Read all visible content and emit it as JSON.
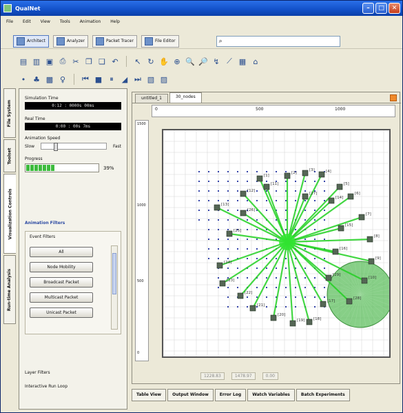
{
  "window": {
    "title": "QualNet"
  },
  "menu": [
    "File",
    "Edit",
    "View",
    "Tools",
    "Animation",
    "Help"
  ],
  "modes": [
    {
      "label": "Architect",
      "active": true
    },
    {
      "label": "Analyzer",
      "active": false
    },
    {
      "label": "Packet Tracer",
      "active": false
    },
    {
      "label": "File Editor",
      "active": false
    }
  ],
  "search": {
    "icon": "search-icon",
    "value": ""
  },
  "side_tabs": [
    "File System",
    "Toolset",
    "Visualization Controls",
    "Run-time Analysis"
  ],
  "sim": {
    "sim_time_label": "Simulation Time",
    "sim_time_value": "0:12 : 0000s  00ms",
    "real_time_label": "Real Time",
    "real_time_value": "0:00 : 00s 7ms",
    "speed_label": "Animation Speed",
    "speed_min": "Slow",
    "speed_max": "Fast",
    "speed_fraction": 0.2,
    "progress_label": "Progress",
    "progress_percent": 39,
    "progress_text": "39%"
  },
  "filters": {
    "title": "Animation Filters",
    "event_title": "Event Filters",
    "buttons": [
      "All",
      "Node Mobility",
      "Broadcast Packet",
      "Multicast Packet",
      "Unicast Packet"
    ],
    "layer_filters": "Layer Filters",
    "interactive_log": "Interactive Run Loop"
  },
  "doc_tabs": [
    "untitled_1",
    "30_nodes"
  ],
  "ruler": {
    "top_ticks": [
      "0",
      "500",
      "1000"
    ],
    "left_ticks": [
      "1500",
      "1000",
      "500",
      "0"
    ]
  },
  "coords": [
    "1228.83",
    "1478.97",
    "0.00"
  ],
  "bottom_tabs": [
    "Table View",
    "Output Window",
    "Error Log",
    "Watch Variables",
    "Batch Experiments"
  ],
  "node_labels": [
    "[1]",
    "[2]",
    "[3]",
    "[4]",
    "[5]",
    "[6]",
    "[7]",
    "[8]",
    "[9]",
    "[10]",
    "[11]",
    "[12]",
    "[13]",
    "[14]",
    "[15]",
    "[16]",
    "[17]",
    "[18]",
    "[19]",
    "[20]",
    "[21]",
    "[22]",
    "[23]",
    "[24]",
    "[25]",
    "[26]",
    "[27]",
    "[28]",
    "[29]"
  ],
  "colors": {
    "link": "#22d022",
    "hub": "#33e633",
    "range_circle": "#5fbf5f",
    "node": "#556655",
    "grid_dot": "#2030a0"
  }
}
